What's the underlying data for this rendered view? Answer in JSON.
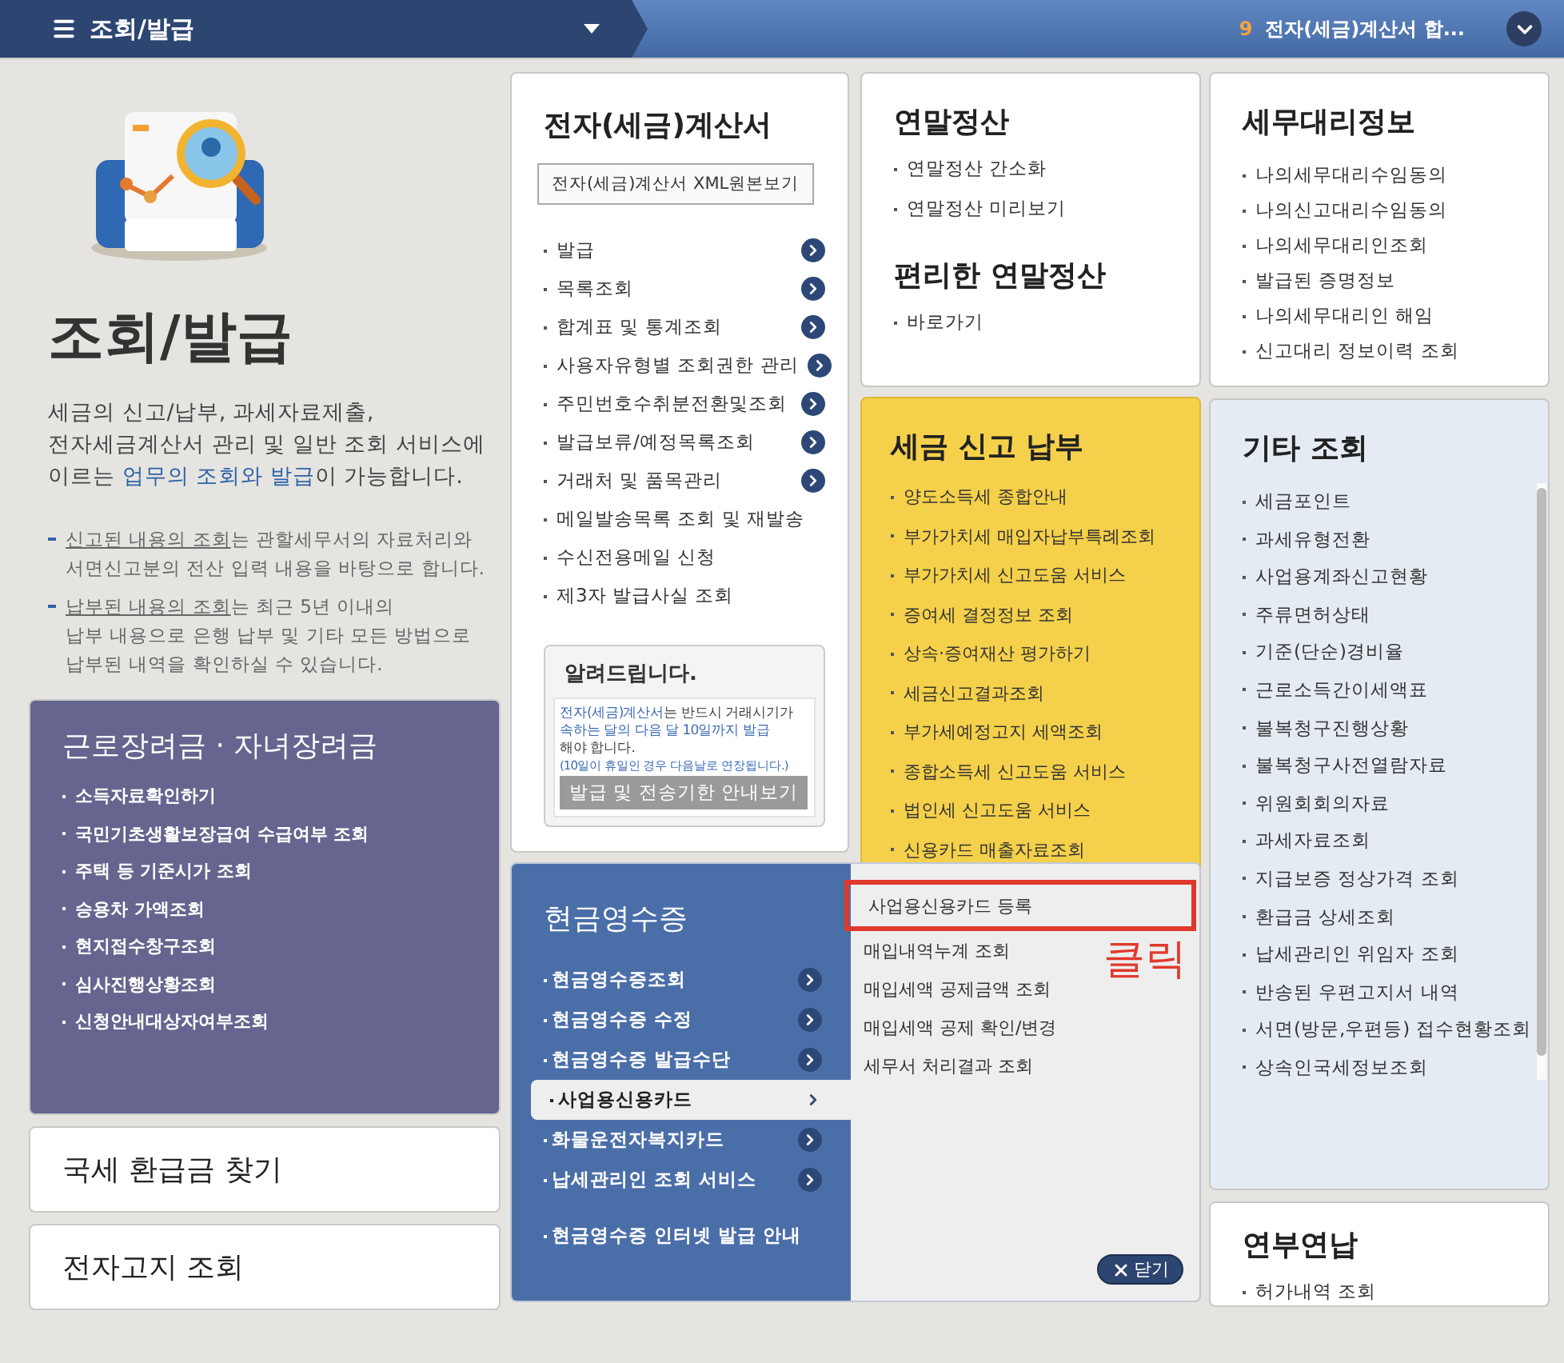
{
  "top_bar": {
    "menu_title": "조회/발급",
    "count": "9",
    "notice": "전자(세금)계산서 합..."
  },
  "intro": {
    "title": "조회/발급",
    "description": "세금의 신고/납부, 과세자료제출,\n전자세금계산서 관리 및 일반 조회 서비스에\n이르는 **업무의 조회와 발급**이 가능합니다.",
    "notes": [
      "**신고된 내용의 조회**는 관할세무서의 자료처리와\n서면신고분의 전산 입력 내용을 바탕으로 합니다.",
      "**납부된 내용의 조회**는 최근 5년 이내의\n납부 내용으로 은행 납부 및 기타 모든 방법으로\n납부된 내역을 확인하실 수 있습니다."
    ]
  },
  "incentive": {
    "title": "근로장려금 · 자녀장려금",
    "items": [
      "소득자료확인하기",
      "국민기초생활보장급여 수급여부 조회",
      "주택 등 기준시가 조회",
      "승용차 가액조회",
      "현지접수창구조회",
      "심사진행상황조회",
      "신청안내대상자여부조회"
    ]
  },
  "refund_link": "국세 환급금 찾기",
  "e_notice_link": "전자고지 조회",
  "e_invoice": {
    "title": "전자(세금)계산서",
    "xml_button": "전자(세금)계산서 XML원본보기",
    "items": [
      {
        "label": "발급",
        "arrow": true
      },
      {
        "label": "목록조회",
        "arrow": true
      },
      {
        "label": "합계표 및 통계조회",
        "arrow": true
      },
      {
        "label": "사용자유형별 조회권한 관리",
        "arrow": true
      },
      {
        "label": "주민번호수취분전환및조회",
        "arrow": true
      },
      {
        "label": "발급보류/예정목록조회",
        "arrow": true
      },
      {
        "label": "거래처 및 품목관리",
        "arrow": true
      },
      {
        "label": "메일발송목록 조회 및 재발송",
        "arrow": false
      },
      {
        "label": "수신전용메일 신청",
        "arrow": false
      },
      {
        "label": "제3자 발급사실 조회",
        "arrow": false
      }
    ],
    "notice": {
      "title": "알려드립니다.",
      "text": "**전자(세금)계산서**는 반드시 거래시기가 **속하는 달의 다음 달 10일까지 발급**\n해야 합니다.",
      "note": "(10일이 휴일인 경우 다음날로 연장됩니다.)",
      "button": "발급 및 전송기한 안내보기"
    }
  },
  "year_end": {
    "title": "연말정산",
    "items": [
      "연말정산 간소화",
      "연말정산 미리보기"
    ],
    "sub_title": "편리한 연말정산",
    "sub_items": [
      "바로가기"
    ]
  },
  "tax_filing": {
    "title": "세금 신고 납부",
    "items": [
      "양도소득세 종합안내",
      "부가가치세 매입자납부특례조회",
      "부가가치세 신고도움 서비스",
      "증여세 결정정보 조회",
      "상속·증여재산 평가하기",
      "세금신고결과조회",
      "부가세예정고지 세액조회",
      "종합소득세 신고도움 서비스",
      "법인세 신고도움 서비스",
      "신용카드 매출자료조회"
    ]
  },
  "cash_receipt": {
    "title": "현금영수증",
    "items": [
      {
        "label": "현금영수증조회",
        "arrow": true,
        "selected": false
      },
      {
        "label": "현금영수증 수정",
        "arrow": true,
        "selected": false
      },
      {
        "label": "현금영수증 발급수단",
        "arrow": true,
        "selected": false
      },
      {
        "label": "사업용신용카드",
        "arrow": true,
        "selected": true
      },
      {
        "label": "화물운전자복지카드",
        "arrow": true,
        "selected": false
      },
      {
        "label": "납세관리인 조회 서비스",
        "arrow": true,
        "selected": false
      },
      {
        "label": "현금영수증 인터넷 발급 안내",
        "arrow": false,
        "selected": false
      }
    ],
    "submenu": {
      "items": [
        {
          "label": "사업용신용카드 등록",
          "highlighted": true
        },
        {
          "label": "매입내역누계 조회",
          "highlighted": false
        },
        {
          "label": "매입세액 공제금액 조회",
          "highlighted": false
        },
        {
          "label": "매입세액 공제 확인/변경",
          "highlighted": false
        },
        {
          "label": "세무서 처리결과 조회",
          "highlighted": false
        }
      ],
      "annotation": "클릭",
      "close": "닫기"
    }
  },
  "agent_info": {
    "title": "세무대리정보",
    "items": [
      "나의세무대리수임동의",
      "나의신고대리수임동의",
      "나의세무대리인조회",
      "발급된 증명정보",
      "나의세무대리인 해임",
      "신고대리 정보이력 조회"
    ]
  },
  "other": {
    "title": "기타 조회",
    "items": [
      "세금포인트",
      "과세유형전환",
      "사업용계좌신고현황",
      "주류면허상태",
      "기준(단순)경비율",
      "근로소득간이세액표",
      "불복청구진행상황",
      "불복청구사전열람자료",
      "위원회회의자료",
      "과세자료조회",
      "지급보증 정상가격 조회",
      "환급금 상세조회",
      "납세관리인 위임자 조회",
      "반송된 우편고지서 내역",
      "서면(방문,우편등) 접수현황조회",
      "상속인국세정보조회"
    ]
  },
  "installment": {
    "title": "연부연납",
    "items": [
      "허가내역 조회"
    ]
  }
}
